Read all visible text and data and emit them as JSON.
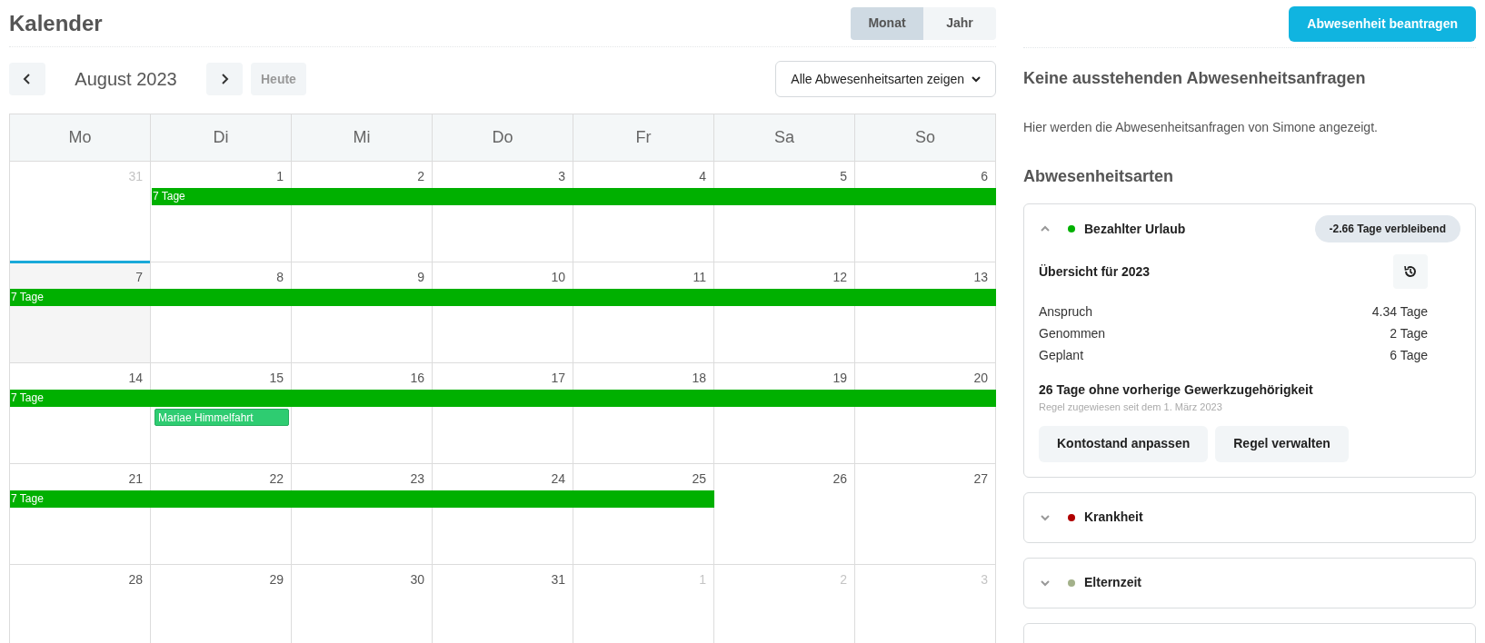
{
  "header": {
    "title": "Kalender",
    "view_tabs": [
      {
        "label": "Monat",
        "selected": true
      },
      {
        "label": "Jahr",
        "selected": false
      }
    ]
  },
  "toolbar": {
    "month": "August 2023",
    "today_button": "Heute",
    "filter": "Alle Abwesenheitsarten zeigen"
  },
  "calendar": {
    "weekdays": [
      "Mo",
      "Di",
      "Mi",
      "Do",
      "Fr",
      "Sa",
      "So"
    ],
    "weeks": [
      {
        "days": [
          {
            "label": "31",
            "kind": "outside"
          },
          {
            "label": "1",
            "kind": "normal"
          },
          {
            "label": "2",
            "kind": "normal"
          },
          {
            "label": "3",
            "kind": "normal"
          },
          {
            "label": "4",
            "kind": "normal"
          },
          {
            "label": "5",
            "kind": "normal"
          },
          {
            "label": "6",
            "kind": "normal"
          }
        ],
        "lanes": [
          [
            {
              "kind": "empty"
            },
            {
              "kind": "start",
              "label": "7 Tage",
              "color": "#00b000"
            },
            {
              "kind": "continue"
            },
            {
              "kind": "continue"
            },
            {
              "kind": "continue"
            },
            {
              "kind": "continue"
            },
            {
              "kind": "continue"
            }
          ]
        ]
      },
      {
        "days": [
          {
            "label": "7",
            "kind": "today"
          },
          {
            "label": "8",
            "kind": "normal"
          },
          {
            "label": "9",
            "kind": "normal"
          },
          {
            "label": "10",
            "kind": "normal"
          },
          {
            "label": "11",
            "kind": "normal"
          },
          {
            "label": "12",
            "kind": "normal"
          },
          {
            "label": "13",
            "kind": "normal"
          }
        ],
        "lanes": [
          [
            {
              "kind": "start",
              "label": "7 Tage",
              "color": "#00b000"
            },
            {
              "kind": "continue"
            },
            {
              "kind": "continue"
            },
            {
              "kind": "continue"
            },
            {
              "kind": "continue"
            },
            {
              "kind": "continue"
            },
            {
              "kind": "continue"
            }
          ]
        ]
      },
      {
        "days": [
          {
            "label": "14",
            "kind": "normal"
          },
          {
            "label": "15",
            "kind": "normal"
          },
          {
            "label": "16",
            "kind": "normal"
          },
          {
            "label": "17",
            "kind": "normal"
          },
          {
            "label": "18",
            "kind": "normal"
          },
          {
            "label": "19",
            "kind": "normal"
          },
          {
            "label": "20",
            "kind": "normal"
          }
        ],
        "lanes": [
          [
            {
              "kind": "start",
              "label": "7 Tage",
              "color": "#00b000"
            },
            {
              "kind": "continue"
            },
            {
              "kind": "continue"
            },
            {
              "kind": "continue"
            },
            {
              "kind": "continue"
            },
            {
              "kind": "continue"
            },
            {
              "kind": "continue"
            }
          ],
          [
            {
              "kind": "empty"
            },
            {
              "kind": "start",
              "label": "Mariae Himmelfahrt",
              "color": "#2ecc71"
            },
            {
              "kind": "empty"
            },
            {
              "kind": "empty"
            },
            {
              "kind": "empty"
            },
            {
              "kind": "empty"
            },
            {
              "kind": "empty"
            }
          ]
        ]
      },
      {
        "days": [
          {
            "label": "21",
            "kind": "normal"
          },
          {
            "label": "22",
            "kind": "normal"
          },
          {
            "label": "23",
            "kind": "normal"
          },
          {
            "label": "24",
            "kind": "normal"
          },
          {
            "label": "25",
            "kind": "normal"
          },
          {
            "label": "26",
            "kind": "normal"
          },
          {
            "label": "27",
            "kind": "normal"
          }
        ],
        "lanes": [
          [
            {
              "kind": "start",
              "label": "7 Tage",
              "color": "#00b000"
            },
            {
              "kind": "continue"
            },
            {
              "kind": "continue"
            },
            {
              "kind": "continue"
            },
            {
              "kind": "continue"
            },
            {
              "kind": "empty"
            },
            {
              "kind": "empty"
            }
          ]
        ]
      },
      {
        "days": [
          {
            "label": "28",
            "kind": "normal"
          },
          {
            "label": "29",
            "kind": "normal"
          },
          {
            "label": "30",
            "kind": "normal"
          },
          {
            "label": "31",
            "kind": "normal"
          },
          {
            "label": "1",
            "kind": "outside"
          },
          {
            "label": "2",
            "kind": "outside"
          },
          {
            "label": "3",
            "kind": "outside"
          }
        ]
      }
    ]
  },
  "side": {
    "request_button": "Abwesenheit beantragen",
    "pending_title": "Keine ausstehenden Abwesenheitsanfragen",
    "pending_text": "Hier werden die Abwesenheitsanfragen von Simone angezeigt.",
    "types_title": "Abwesenheitsarten",
    "types": [
      {
        "name": "Bezahlter Urlaub",
        "color": "#00b000",
        "expanded": true,
        "badge": "-2.66 Tage verbleibend",
        "overview_title": "Übersicht für 2023",
        "rows": [
          {
            "label": "Anspruch",
            "value": "4.34 Tage"
          },
          {
            "label": "Genommen",
            "value": "2 Tage"
          },
          {
            "label": "Geplant",
            "value": "6 Tage"
          }
        ],
        "rule_title": "26 Tage ohne vorherige Gewerkzugehörigkeit",
        "rule_subtitle": "Regel zugewiesen seit dem 1. März 2023",
        "buttons": [
          "Kontostand anpassen",
          "Regel verwalten"
        ]
      },
      {
        "name": "Krankheit",
        "color": "#b00000",
        "expanded": false
      },
      {
        "name": "Elternzeit",
        "color": "#a3b18a",
        "expanded": false
      }
    ]
  }
}
